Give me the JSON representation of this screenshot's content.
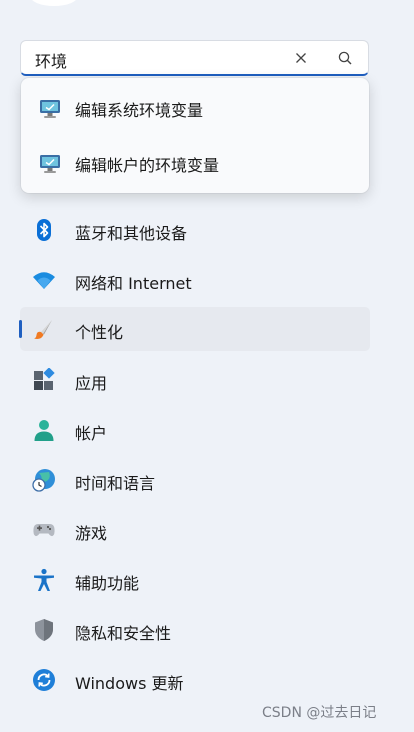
{
  "search": {
    "query": "环境",
    "clear_icon": "close-icon",
    "submit_icon": "search-icon"
  },
  "suggestions": [
    {
      "label": "编辑系统环境变量",
      "icon": "monitor-settings-icon"
    },
    {
      "label": "编辑帐户的环境变量",
      "icon": "monitor-settings-icon"
    }
  ],
  "nav": {
    "items": [
      {
        "label": "蓝牙和其他设备",
        "icon": "bluetooth-icon"
      },
      {
        "label": "网络和 Internet",
        "icon": "wifi-icon"
      },
      {
        "label": "个性化",
        "icon": "paintbrush-icon",
        "selected": true
      },
      {
        "label": "应用",
        "icon": "apps-icon"
      },
      {
        "label": "帐户",
        "icon": "account-icon"
      },
      {
        "label": "时间和语言",
        "icon": "globe-clock-icon"
      },
      {
        "label": "游戏",
        "icon": "gamepad-icon"
      },
      {
        "label": "辅助功能",
        "icon": "accessibility-icon"
      },
      {
        "label": "隐私和安全性",
        "icon": "shield-icon"
      },
      {
        "label": "Windows 更新",
        "icon": "sync-icon"
      }
    ]
  },
  "watermark": "CSDN @过去日记",
  "colors": {
    "accent": "#1f5fc0",
    "background": "#eef2f8",
    "selected_bg": "#e6e9ef"
  }
}
